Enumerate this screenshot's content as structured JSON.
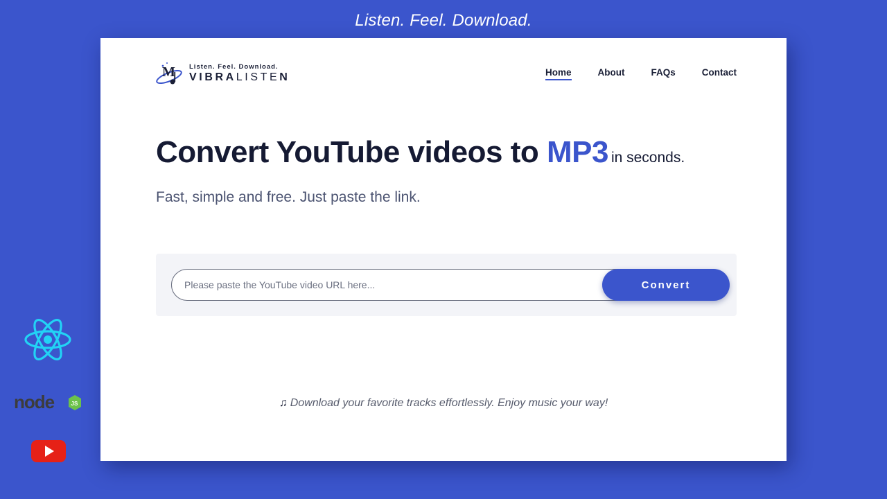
{
  "banner": {
    "tagline": "Listen. Feel. Download."
  },
  "header": {
    "logo_tagline": "Listen. Feel. Download.",
    "logo_name_bold": "VIBRA",
    "logo_name_thin": "LISTE",
    "logo_name_end": "N",
    "nav": [
      {
        "label": "Home",
        "active": true
      },
      {
        "label": "About",
        "active": false
      },
      {
        "label": "FAQs",
        "active": false
      },
      {
        "label": "Contact",
        "active": false
      }
    ]
  },
  "hero": {
    "title_main": "Convert YouTube videos to ",
    "title_accent": "MP3",
    "title_small": "in seconds.",
    "subtitle": "Fast, simple and free. Just paste the link."
  },
  "converter": {
    "input_value": "",
    "input_placeholder": "Please paste the YouTube video URL here...",
    "button_label": "Convert"
  },
  "footer": {
    "note_icon": "music-note-icon",
    "note_text": "Download your favorite tracks effortlessly. Enjoy music your way!"
  },
  "tech_icons": [
    "react-icon",
    "nodejs-icon",
    "youtube-icon"
  ],
  "colors": {
    "background": "#3b55cc",
    "accent": "#3b55cc",
    "text_dark": "#151a33",
    "react": "#22d3f5",
    "node_green": "#6cc24a",
    "youtube_red": "#e62117"
  }
}
